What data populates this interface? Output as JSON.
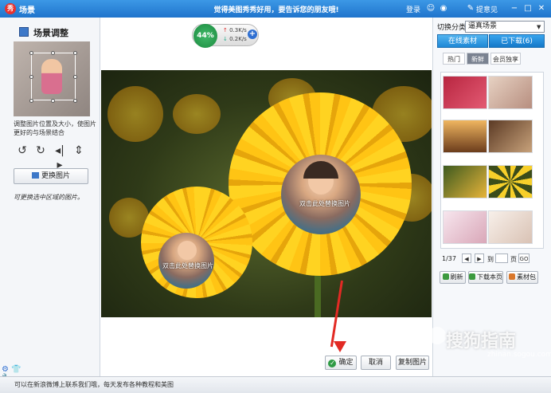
{
  "titlebar": {
    "app_logo": "秀",
    "app_title": "场景",
    "slogan": "觉得美图秀秀好用，要告诉您的朋友哦!",
    "login": "登录",
    "help": "提意见",
    "icons": [
      "qq-icon",
      "weibo-icon",
      "help-bubble-icon"
    ]
  },
  "window": {
    "minimize": "−",
    "maximize": "□",
    "close": "✕"
  },
  "left_panel": {
    "title": "场景调整",
    "hint": "调整图片位置及大小，使图片更好的与场景结合",
    "rotate_icons": [
      "rotate-left-icon",
      "rotate-right-icon",
      "flip-horizontal-icon",
      "flip-vertical-icon"
    ],
    "replace_button": "更换图片",
    "annotation": "可更换选中区域的图片。"
  },
  "network_widget": {
    "percent": "44%",
    "up": "0.3K/s",
    "down": "0.2K/s",
    "plus": "+"
  },
  "canvas": {
    "photo_label_1": "双击此处替换图片",
    "photo_label_2": "双击此处替换图片"
  },
  "actions": {
    "ok": "确定",
    "cancel": "取消",
    "reset": "复制图片"
  },
  "right_panel": {
    "category_label": "切换分类",
    "category_value": "逼真场景",
    "tab_online": "在线素材",
    "tab_downloaded": "已下载(6)",
    "subtabs": [
      "热门",
      "新鲜",
      "会员独享"
    ],
    "pager": {
      "page": "1/37",
      "prev": "◀",
      "next": "▶",
      "to": "到",
      "unit": "页",
      "go": "GO"
    },
    "buttons": [
      "刷新",
      "下载本页",
      "素材包"
    ]
  },
  "status": {
    "text": "可以在新浪微博上联系我们哦，每天发布各种教程和美图"
  },
  "watermark": {
    "text": "搜狗指南",
    "url": "zhinan.sogou.com"
  },
  "colors": {
    "titlebar": "#1f74cc",
    "accent": "#1e88d6",
    "arrow": "#e22a24",
    "ok": "#2f9b45"
  }
}
